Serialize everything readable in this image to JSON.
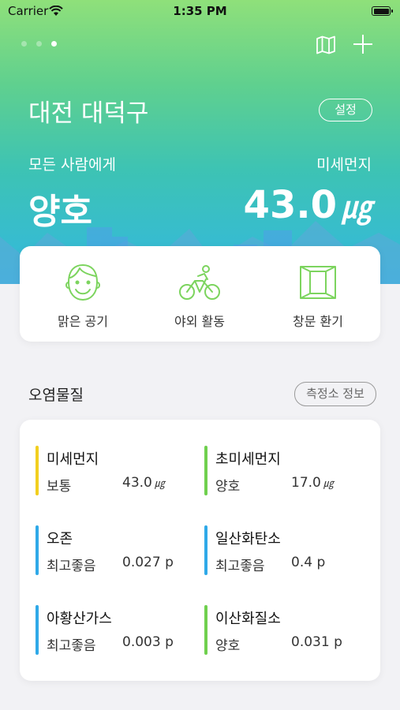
{
  "status_bar": {
    "carrier": "Carrier",
    "time": "1:35 PM"
  },
  "header": {
    "page_dots": 3,
    "active_page": 3,
    "location": "대전 대덕구",
    "settings_label": "설정",
    "target_label": "모든 사람에게",
    "pollutant_label": "미세먼지",
    "grade": "양호",
    "value": "43.0",
    "unit": "㎍"
  },
  "activities": [
    {
      "label": "맑은 공기",
      "icon": "smiley-face-icon"
    },
    {
      "label": "야외 활동",
      "icon": "cyclist-icon"
    },
    {
      "label": "창문 환기",
      "icon": "open-window-icon"
    }
  ],
  "pollutants_section": {
    "title": "오염물질",
    "station_info_label": "측정소 정보"
  },
  "pollutants": [
    {
      "name": "미세먼지",
      "grade": "보통",
      "value": "43.0",
      "unit": "㎍",
      "color": "#f2cf1f"
    },
    {
      "name": "초미세먼지",
      "grade": "양호",
      "value": "17.0",
      "unit": "㎍",
      "color": "#6fd04e"
    },
    {
      "name": "오존",
      "grade": "최고좋음",
      "value": "0.027 p",
      "unit": "",
      "color": "#2fa9e8"
    },
    {
      "name": "일산화탄소",
      "grade": "최고좋음",
      "value": "0.4 p",
      "unit": "",
      "color": "#2fa9e8"
    },
    {
      "name": "아황산가스",
      "grade": "최고좋음",
      "value": "0.003 p",
      "unit": "",
      "color": "#2fa9e8"
    },
    {
      "name": "이산화질소",
      "grade": "양호",
      "value": "0.031 p",
      "unit": "",
      "color": "#6fd04e"
    }
  ],
  "colors": {
    "accent_green": "#7cd45e",
    "sky_blue": "#33b8e0"
  }
}
